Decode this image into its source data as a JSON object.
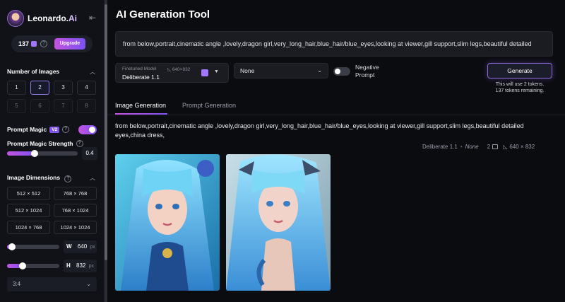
{
  "sidebar": {
    "brand": "Leonardo.",
    "brand_suffix": "Ai",
    "tokens": "137",
    "upgrade_label": "Upgrade",
    "number_of_images_title": "Number of Images",
    "image_counts": [
      {
        "label": "1",
        "state": "normal"
      },
      {
        "label": "2",
        "state": "active"
      },
      {
        "label": "3",
        "state": "normal"
      },
      {
        "label": "4",
        "state": "normal"
      },
      {
        "label": "5",
        "state": "disabled"
      },
      {
        "label": "6",
        "state": "disabled"
      },
      {
        "label": "7",
        "state": "disabled"
      },
      {
        "label": "8",
        "state": "disabled"
      }
    ],
    "prompt_magic_label": "Prompt Magic",
    "prompt_magic_version": "V2",
    "prompt_magic_enabled": true,
    "prompt_magic_strength_label": "Prompt Magic Strength",
    "prompt_magic_strength_value": "0.4",
    "image_dimensions_title": "Image Dimensions",
    "dimensions": [
      "512 × 512",
      "768 × 768",
      "512 × 1024",
      "768 × 1024",
      "1024 × 768",
      "1024 × 1024"
    ],
    "width_label": "W",
    "width_value": "640",
    "height_label": "H",
    "height_value": "832",
    "unit": "px",
    "width_slider_fraction": 0.1,
    "height_slider_fraction": 0.3,
    "aspect_ratio": "3:4"
  },
  "main": {
    "title": "AI Generation Tool",
    "prompt": "from below,portrait,cinematic angle ,lovely,dragon girl,very_long_hair,blue_hair/blue_eyes,looking at viewer,gill support,slim legs,beautiful detailed",
    "model_label": "Finetuned Model",
    "model_resolution": "640×832",
    "model_name": "Deliberate 1.1",
    "style_value": "None",
    "negative_prompt_label": "Negative Prompt",
    "negative_prompt_enabled": false,
    "generate_label": "Generate",
    "token_note_line1": "This will use 2 tokens.",
    "token_note_line2": "137 tokens remaining.",
    "tabs": [
      {
        "label": "Image Generation",
        "active": true
      },
      {
        "label": "Prompt Generation",
        "active": false
      }
    ],
    "result": {
      "prompt": "from below,portrait,cinematic angle ,lovely,dragon girl,very_long_hair,blue_hair/blue_eyes,looking at viewer,gill support,slim legs,beautiful detailed eyes,china dress,",
      "model": "Deliberate 1.1",
      "style": "None",
      "count": "2",
      "size": "640 × 832"
    }
  }
}
